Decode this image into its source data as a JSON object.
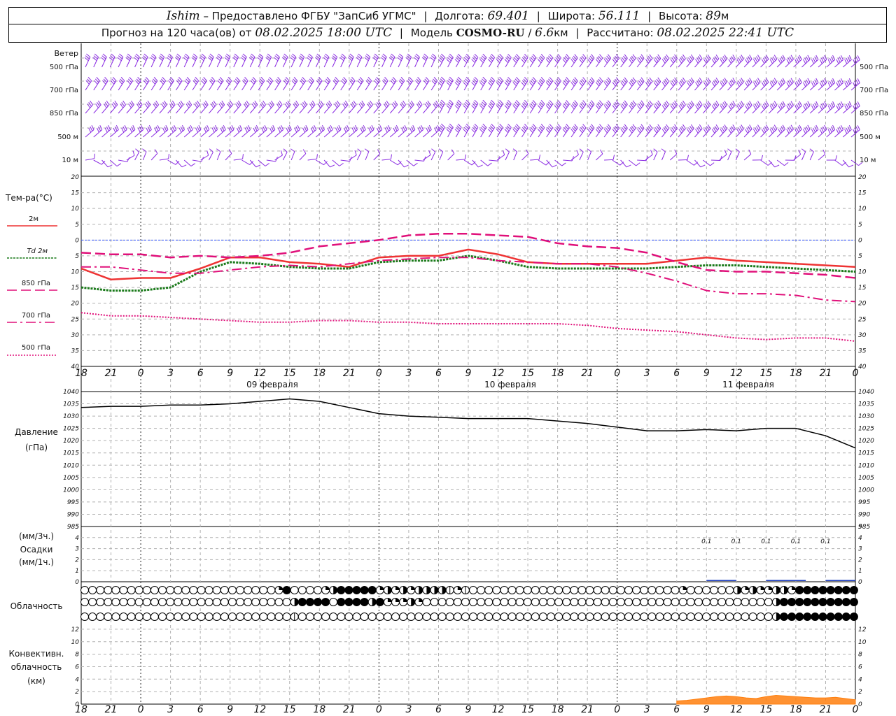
{
  "header": {
    "station": "Ishim",
    "dash": "–",
    "provider": "Предоставлено ФГБУ \"ЗапСиб УГМС\"",
    "lon_label": "Долгота:",
    "lon": "69.401",
    "lat_label": "Широта:",
    "lat": "56.111",
    "alt_label": "Высота:",
    "alt": "89",
    "alt_unit": "м",
    "forecast_label": "Прогноз на 120 часа(ов) от",
    "forecast_start": "08.02.2025 18:00 UTC",
    "model_label": "Модель",
    "model": "COSMO-RU",
    "resolution": "6.6",
    "res_unit": "км",
    "calc_label": "Рассчитано:",
    "calc_time": "08.02.2025 22:41 UTC"
  },
  "wind_panel": {
    "title": "Ветер",
    "levels": [
      "500 гПа",
      "700 гПа",
      "850 гПа",
      "500 м",
      "10 м"
    ]
  },
  "colors": {
    "wind": "#8a2be2",
    "t2m": "#ee3333",
    "td2m": "#1a7a1a",
    "t850": "#e0107a",
    "t700": "#e0107a",
    "t500": "#e0107a",
    "zero_line": "#3355ff",
    "grid": "#b0b0b0",
    "pressure": "#000000",
    "precip": "#1f3fbf",
    "convective": "#ff7f0e"
  },
  "chart_data": [
    {
      "type": "line",
      "title": "Тем-ра(°С)",
      "ylim": [
        -40,
        20
      ],
      "yticks": [
        -40,
        -35,
        -30,
        -25,
        -20,
        -15,
        -10,
        -5,
        0,
        5,
        10,
        15,
        20
      ],
      "x_hours": [
        0,
        3,
        6,
        9,
        12,
        15,
        18,
        21,
        24,
        27,
        30,
        33,
        36,
        39,
        42,
        45,
        48,
        51,
        54,
        57,
        60,
        63,
        66,
        69,
        72,
        75,
        78
      ],
      "x_tick_labels": [
        "18",
        "21",
        "0",
        "3",
        "6",
        "9",
        "12",
        "15",
        "18",
        "21",
        "0",
        "3",
        "6",
        "9",
        "12",
        "15",
        "18",
        "21",
        "0",
        "3",
        "6",
        "9",
        "12",
        "15",
        "18",
        "21",
        "0"
      ],
      "day_labels": [
        {
          "hour": 18,
          "label": "09 февраля"
        },
        {
          "hour": 42,
          "label": "10 февраля"
        },
        {
          "hour": 66,
          "label": "11 февраля"
        }
      ],
      "series": [
        {
          "name": "2м",
          "style": "solid",
          "values": [
            -9,
            -12.5,
            -12,
            -12,
            -9,
            -5.5,
            -5.5,
            -7,
            -7.5,
            -8.5,
            -5.5,
            -5,
            -5,
            -3,
            -4.5,
            -7,
            -7.5,
            -7.5,
            -7.5,
            -7.5,
            -6.5,
            -5.5,
            -6.5,
            -7,
            -7.5,
            -8,
            -8.5
          ]
        },
        {
          "name": "Td 2м",
          "style": "dotted",
          "values": [
            -15,
            -16,
            -16,
            -15,
            -10,
            -7,
            -7.5,
            -8.5,
            -9,
            -9,
            -7,
            -6.5,
            -6.5,
            -5,
            -6.5,
            -8.5,
            -9,
            -9,
            -9,
            -9,
            -8.5,
            -8,
            -8,
            -8.5,
            -9,
            -9.5,
            -10
          ]
        },
        {
          "name": "850 гПа",
          "style": "dashed",
          "values": [
            -4,
            -4.5,
            -4.5,
            -5.5,
            -5,
            -5.5,
            -5,
            -4,
            -2,
            -1,
            0,
            1.5,
            2,
            2,
            1.5,
            1,
            -1,
            -2,
            -2.5,
            -4,
            -7,
            -9.5,
            -10,
            -10,
            -10.5,
            -11,
            -12
          ]
        },
        {
          "name": "700 гПа",
          "style": "dashdot",
          "values": [
            -8.5,
            -8.5,
            -9.5,
            -10.5,
            -10.5,
            -9.5,
            -8.5,
            -8,
            -8.5,
            -7.5,
            -6.5,
            -6,
            -5.5,
            -5.5,
            -6.5,
            -7,
            -7.5,
            -7.5,
            -8.5,
            -10.5,
            -13,
            -16,
            -17,
            -17,
            -17.5,
            -19,
            -19.5
          ]
        },
        {
          "name": "500 гПа",
          "style": "densedot",
          "values": [
            -23,
            -24,
            -24,
            -24.5,
            -25,
            -25.5,
            -26,
            -26,
            -25.5,
            -25.5,
            -26,
            -26,
            -26.5,
            -26.5,
            -26.5,
            -26.5,
            -26.5,
            -27,
            -28,
            -28.5,
            -29,
            -30,
            -31,
            -31.5,
            -31,
            -31,
            -32
          ]
        }
      ]
    },
    {
      "type": "line",
      "title": "Давление",
      "ylabel": "(гПа)",
      "ylim": [
        985,
        1040
      ],
      "yticks": [
        985,
        990,
        995,
        1000,
        1005,
        1010,
        1015,
        1020,
        1025,
        1030,
        1035,
        1040
      ],
      "x_hours": [
        0,
        3,
        6,
        9,
        12,
        15,
        18,
        21,
        24,
        27,
        30,
        33,
        36,
        39,
        42,
        45,
        48,
        51,
        54,
        57,
        60,
        63,
        66,
        69,
        72,
        75,
        78
      ],
      "series": [
        {
          "name": "",
          "values": [
            1033.5,
            1034,
            1034,
            1034.5,
            1034.5,
            1035,
            1036,
            1037,
            1036,
            1033.5,
            1031,
            1030,
            1029.5,
            1029,
            1029,
            1029,
            1028,
            1027,
            1025.5,
            1024,
            1024,
            1024.5,
            1024,
            1025,
            1025,
            1022,
            1017
          ]
        }
      ]
    },
    {
      "type": "bar",
      "title": "Осадки",
      "ylabel_top": "(мм/3ч.)",
      "ylabel_bottom": "(мм/1ч.)",
      "ylim": [
        0,
        5
      ],
      "yticks": [
        0,
        1,
        2,
        3,
        4,
        5
      ],
      "annotations": [
        {
          "hour": 63,
          "text": "0.1"
        },
        {
          "hour": 66,
          "text": "0.1"
        },
        {
          "hour": 69,
          "text": "0.1"
        },
        {
          "hour": 72,
          "text": "0.1"
        },
        {
          "hour": 75,
          "text": "0.1"
        }
      ],
      "bars": [
        {
          "from": 63,
          "to": 66,
          "value": 0.1
        },
        {
          "from": 69,
          "to": 73,
          "value": 0.1
        },
        {
          "from": 75,
          "to": 78,
          "value": 0.1
        }
      ]
    },
    {
      "type": "table",
      "title": "Облачность",
      "x_step_hours": 1,
      "rows": [
        "0000000000000000000000000240000234444423232333312100000000000000000000000000020000003232233244444444",
        "0000000000000000000000000003444404444342223200000000000000000000000000000000000000000000034444444444",
        "0000000000000000000000000001000000000000000000000000000000000000000000000000000000000000034444444444"
      ]
    },
    {
      "type": "area",
      "title": "Конвективн.",
      "subtitle": "облачность",
      "ylabel": "(км)",
      "ylim": [
        0,
        13
      ],
      "yticks": [
        0,
        2,
        4,
        6,
        8,
        10,
        12
      ],
      "x_hours": [
        60,
        61,
        62,
        63,
        64,
        65,
        66,
        67,
        68,
        69,
        70,
        71,
        72,
        73,
        74,
        75,
        76,
        77,
        78
      ],
      "values": [
        0.5,
        0.6,
        0.8,
        1.0,
        1.2,
        1.3,
        1.2,
        1.0,
        0.9,
        1.2,
        1.4,
        1.3,
        1.2,
        1.1,
        1.0,
        1.0,
        1.1,
        0.9,
        0.7
      ]
    }
  ]
}
